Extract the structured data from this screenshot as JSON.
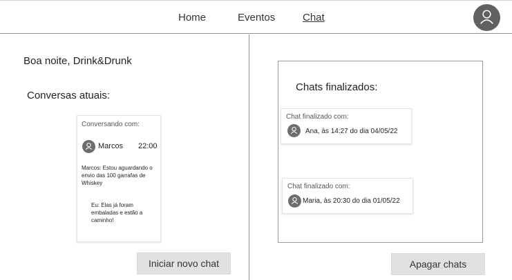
{
  "nav": {
    "home": "Home",
    "eventos": "Eventos",
    "chat": "Chat"
  },
  "greeting": "Boa noite, Drink&Drunk",
  "current": {
    "heading": "Conversas atuais:",
    "card": {
      "title": "Conversando com:",
      "name": "Marcos",
      "time": "22:00",
      "message_in": "Marcos: Estou aguardando o envio das 100 garrafas de Whiskey",
      "message_out": "Eu: Elas já foram embaladas e estão a caminho!"
    },
    "new_chat_button": "Iniciar novo chat"
  },
  "finished": {
    "heading": "Chats finalizados:",
    "items": [
      {
        "title": "Chat finalizado com:",
        "text": "Ana, às 14:27 do dia 04/05/22"
      },
      {
        "title": "Chat finalizado com:",
        "text": "Maria, às 20:30 do dia 01/05/22"
      }
    ],
    "delete_button": "Apagar chats"
  },
  "icons": {
    "profile": "user-icon",
    "avatar": "user-icon"
  },
  "colors": {
    "avatar_bg": "#616161",
    "button_bg": "#e1e1e1"
  }
}
